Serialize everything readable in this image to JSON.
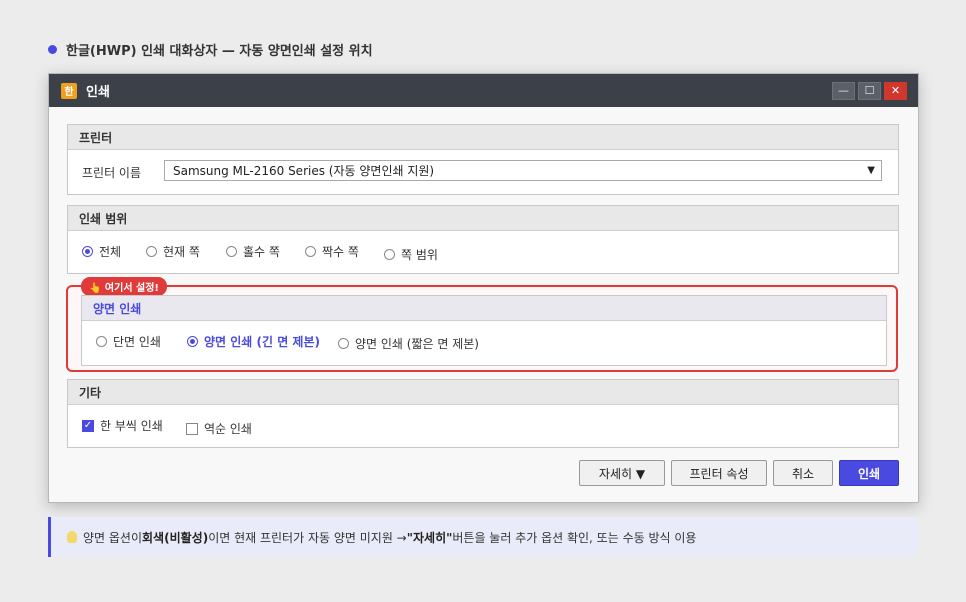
{
  "heading": "한글(HWP) 인쇄 대화상자 — 자동 양면인쇄 설정 위치",
  "window": {
    "app_icon": "한",
    "title": "인쇄",
    "min": "—",
    "max": "☐",
    "close": "✕"
  },
  "printer": {
    "title": "프린터",
    "name_label": "프린터 이름",
    "selected": "Samsung ML-2160 Series (자동 양면인쇄 지원)",
    "arrow": "▼"
  },
  "range": {
    "title": "인쇄 범위",
    "options": [
      "전체",
      "현재 쪽",
      "홀수 쪽",
      "짝수 쪽",
      "쪽 범위"
    ],
    "selected_index": 0
  },
  "duplex": {
    "tag": "👆 여기서 설정!",
    "title": "양면 인쇄",
    "options": [
      "단면 인쇄",
      "양면 인쇄 (긴 면 제본)",
      "양면 인쇄 (짧은 면 제본)"
    ],
    "selected_index": 1
  },
  "etc": {
    "title": "기타",
    "per_copy": "한 부씩 인쇄",
    "per_copy_checked": true,
    "reverse": "역순 인쇄",
    "reverse_checked": false
  },
  "buttons": {
    "details": "자세히 ▼",
    "properties": "프린터 속성",
    "cancel": "취소",
    "print": "인쇄"
  },
  "tip": {
    "part1": "양면 옵션이 ",
    "bold1": "회색(비활성)",
    "part2": "이면 현재 프린터가 자동 양면 미지원 → ",
    "bold2": "\"자세히\"",
    "part3": " 버튼을 눌러 추가 옵션 확인, 또는 수동 방식 이용"
  },
  "colors": {
    "accent": "#4a4ae0",
    "highlight": "#e03a3a",
    "titlebar": "#3c4048"
  }
}
